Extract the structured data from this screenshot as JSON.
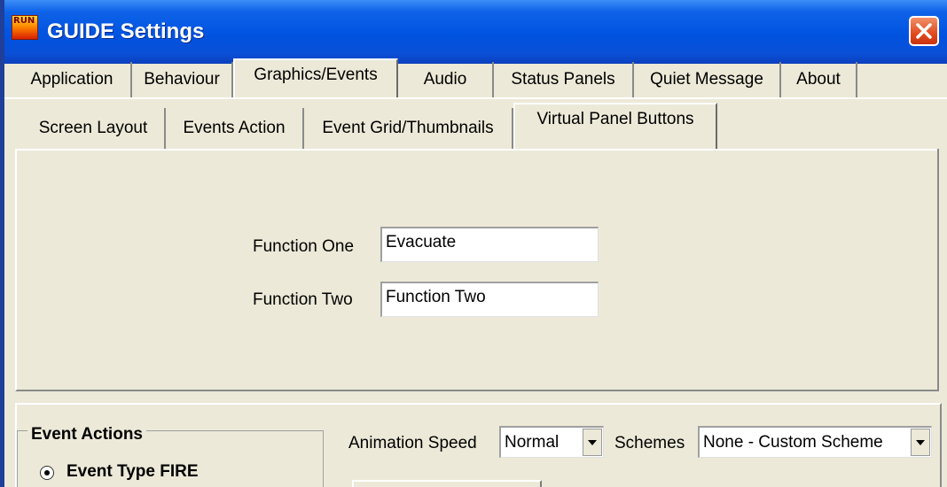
{
  "window": {
    "title": "GUIDE Settings",
    "app_icon_text": "RUN",
    "brand_color": "#0a4fd6",
    "close_color": "#e04b1f"
  },
  "main_tabs": [
    {
      "label": "Application"
    },
    {
      "label": "Behaviour"
    },
    {
      "label": "Graphics/Events",
      "active": true
    },
    {
      "label": "Audio"
    },
    {
      "label": "Status Panels"
    },
    {
      "label": "Quiet Message"
    },
    {
      "label": "About"
    }
  ],
  "sub_tabs": [
    {
      "label": "Screen Layout"
    },
    {
      "label": "Events Action"
    },
    {
      "label": "Event Grid/Thumbnails"
    },
    {
      "label": "Virtual Panel Buttons",
      "active": true
    }
  ],
  "virtual_panel": {
    "function_one": {
      "label": "Function One",
      "value": "Evacuate"
    },
    "function_two": {
      "label": "Function Two",
      "value": "Function Two"
    }
  },
  "event_actions": {
    "title": "Event Actions",
    "option_label": "Event Type FIRE",
    "selected": true
  },
  "animation_speed": {
    "label": "Animation Speed",
    "value": "Normal"
  },
  "schemes": {
    "label": "Schemes",
    "value": "None - Custom Scheme"
  }
}
